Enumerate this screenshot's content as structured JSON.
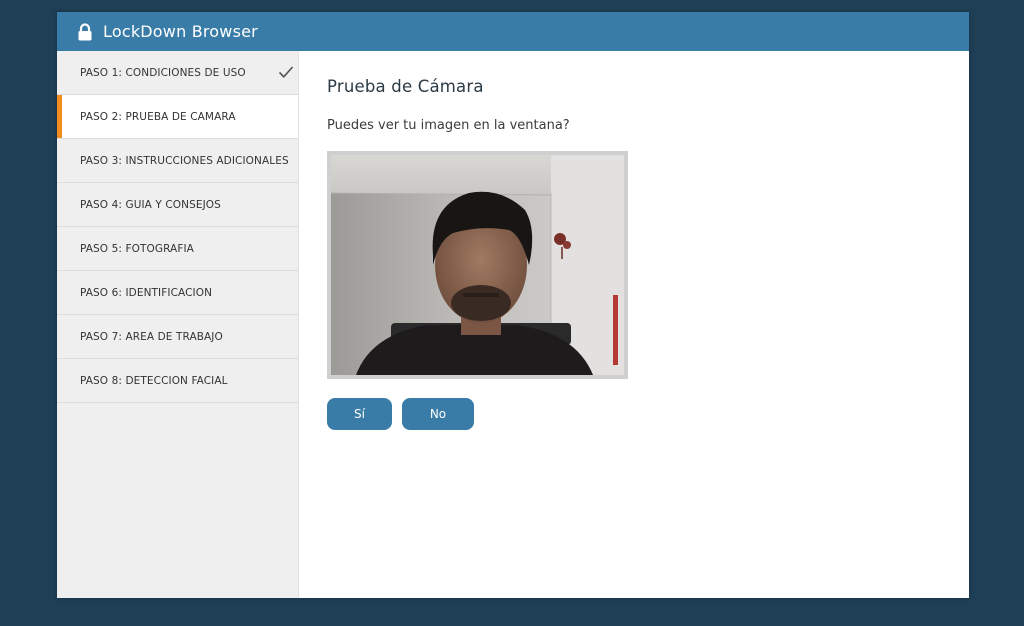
{
  "app": {
    "title": "LockDown Browser"
  },
  "sidebar": {
    "steps": [
      {
        "label": "PASO 1: CONDICIONES DE USO",
        "completed": true
      },
      {
        "label": "PASO 2: PRUEBA DE CAMARA",
        "active": true
      },
      {
        "label": "PASO 3: INSTRUCCIONES ADICIONALES"
      },
      {
        "label": "PASO 4: GUIA Y CONSEJOS"
      },
      {
        "label": "PASO 5: FOTOGRAFIA"
      },
      {
        "label": "PASO 6: IDENTIFICACION"
      },
      {
        "label": "PASO 7: AREA DE TRABAJO"
      },
      {
        "label": "PASO 8: DETECCION FACIAL"
      }
    ]
  },
  "main": {
    "heading": "Prueba de Cámara",
    "question": "Puedes ver tu imagen en la ventana?",
    "yes_label": "Sí",
    "no_label": "No"
  },
  "colors": {
    "titlebar": "#3a7ca8",
    "background": "#1e3f56",
    "active_accent": "#f28c1e",
    "button": "#3a7ca8"
  },
  "icons": {
    "title": "lock-icon",
    "completed_step": "check-icon"
  }
}
